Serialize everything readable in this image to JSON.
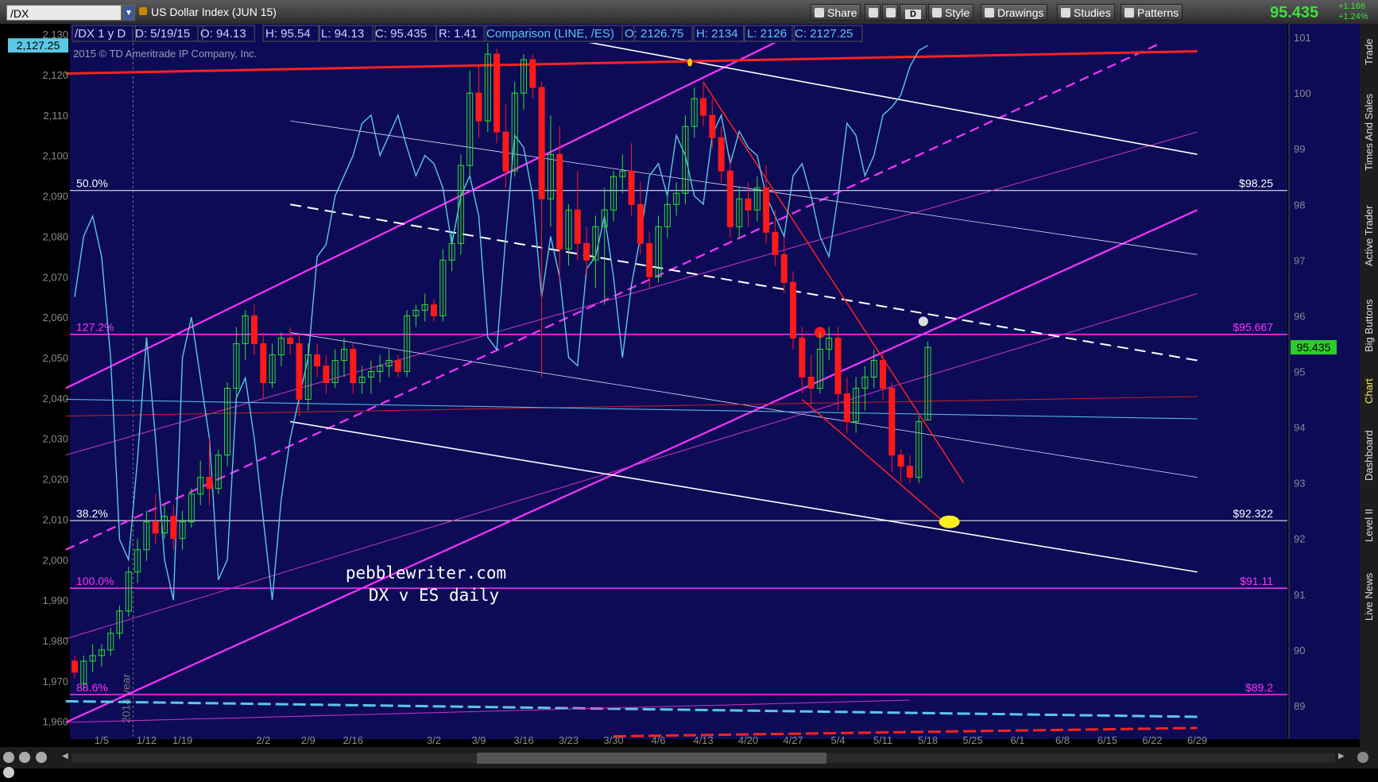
{
  "toolbar": {
    "symbol": "/DX",
    "instrument": "US Dollar Index (JUN 15)",
    "buttons": {
      "share": "Share",
      "d": "D",
      "style": "Style",
      "drawings": "Drawings",
      "studies": "Studies",
      "patterns": "Patterns"
    },
    "last_price": "95.435",
    "change_abs": "+1.166",
    "change_pct": "+1.24%"
  },
  "sidebar": {
    "tabs": [
      "Trade",
      "Times And Sales",
      "Active Trader",
      "Big Buttons",
      "Chart",
      "Dashboard",
      "Level II",
      "Live News"
    ],
    "active": "Chart"
  },
  "colors": {
    "background": "#0d0b56",
    "up": "#2ee02e",
    "down": "#ff1a1a",
    "comparison": "#5bc8e6",
    "magenta": "#ff33ff",
    "red_line": "#ff2222",
    "white_line": "#ffffff"
  },
  "chart_data": {
    "type": "candlestick",
    "header": {
      "symbol_period": "/DX 1 y D",
      "date": "D: 5/19/15",
      "open": "O: 94.13",
      "high": "H: 95.54",
      "low": "L: 94.13",
      "close": "C: 95.435",
      "range": "R: 1.41",
      "comparison": "Comparison (LINE, /ES)",
      "cmp_open": "O: 2126.75",
      "cmp_high": "H: 2134",
      "cmp_low": "L: 2126",
      "cmp_close": "C: 2127.25"
    },
    "copyright": "2015 © TD Ameritrade IP Company, Inc.",
    "watermark": [
      "pebblewriter.com",
      "DX v ES daily"
    ],
    "year_marker": "2014 year",
    "right_axis": {
      "min": 88.5,
      "max": 101.2,
      "ticks": [
        89,
        90,
        91,
        92,
        93,
        94,
        95,
        96,
        97,
        98,
        99,
        100,
        101
      ]
    },
    "left_axis": {
      "min": 1957,
      "max": 2132,
      "ticks": [
        1960,
        1970,
        1980,
        1990,
        2000,
        2010,
        2020,
        2030,
        2040,
        2050,
        2060,
        2070,
        2080,
        2090,
        2100,
        2110,
        2120,
        2130
      ],
      "tick_labels": [
        "1,960",
        "1,970",
        "1,980",
        "1,990",
        "2,000",
        "2,010",
        "2,020",
        "2,030",
        "2,040",
        "2,050",
        "2,060",
        "2,070",
        "2,080",
        "2,090",
        "2,100",
        "2,110",
        "2,120",
        "2,130"
      ],
      "current_label": "2,127.25",
      "current_value": 2127.25
    },
    "price_label": "95.435",
    "x_ticks": [
      {
        "label": "1/5",
        "i": 3
      },
      {
        "label": "1/12",
        "i": 8
      },
      {
        "label": "1/19",
        "i": 12
      },
      {
        "label": "2/2",
        "i": 21
      },
      {
        "label": "2/9",
        "i": 26
      },
      {
        "label": "2/16",
        "i": 31
      },
      {
        "label": "3/2",
        "i": 40
      },
      {
        "label": "3/9",
        "i": 45
      },
      {
        "label": "3/16",
        "i": 50
      },
      {
        "label": "3/23",
        "i": 55
      },
      {
        "label": "3/30",
        "i": 60
      },
      {
        "label": "4/6",
        "i": 65
      },
      {
        "label": "4/13",
        "i": 70
      },
      {
        "label": "4/20",
        "i": 75
      },
      {
        "label": "4/27",
        "i": 80
      },
      {
        "label": "5/4",
        "i": 85
      },
      {
        "label": "5/11",
        "i": 90
      },
      {
        "label": "5/18",
        "i": 95
      },
      {
        "label": "5/25",
        "i": 100
      },
      {
        "label": "6/1",
        "i": 105
      },
      {
        "label": "6/8",
        "i": 110
      },
      {
        "label": "6/15",
        "i": 115
      },
      {
        "label": "6/22",
        "i": 120
      },
      {
        "label": "6/29",
        "i": 125
      }
    ],
    "fib_levels": [
      {
        "pct": "50.0%",
        "price": "$98.25",
        "value": 98.25,
        "color": "#ffffff"
      },
      {
        "pct": "127.2%",
        "price": "$95.667",
        "value": 95.667,
        "color": "#ff33ff"
      },
      {
        "pct": "38.2%",
        "price": "$92.322",
        "value": 92.322,
        "color": "#ffffff"
      },
      {
        "pct": "100.0%",
        "price": "$91.11",
        "value": 91.11,
        "color": "#ff33ff"
      },
      {
        "pct": "88.6%",
        "price": "$89.2",
        "value": 89.2,
        "color": "#ff33ff"
      }
    ],
    "candles": [
      [
        89.8,
        89.9,
        89.5,
        89.6
      ],
      [
        89.4,
        89.9,
        89.3,
        89.8
      ],
      [
        89.8,
        90.1,
        89.6,
        89.9
      ],
      [
        89.9,
        90.1,
        89.7,
        90.0
      ],
      [
        90.0,
        90.4,
        89.9,
        90.3
      ],
      [
        90.3,
        90.8,
        90.2,
        90.7
      ],
      [
        90.7,
        91.5,
        90.6,
        91.4
      ],
      [
        91.4,
        92.0,
        91.2,
        91.8
      ],
      [
        91.8,
        92.5,
        91.6,
        92.3
      ],
      [
        92.3,
        92.8,
        91.9,
        92.1
      ],
      [
        92.1,
        92.6,
        92.0,
        92.4
      ],
      [
        92.4,
        92.6,
        91.8,
        92.0
      ],
      [
        92.0,
        92.5,
        91.8,
        92.3
      ],
      [
        92.3,
        92.9,
        92.2,
        92.8
      ],
      [
        92.8,
        93.4,
        92.6,
        93.1
      ],
      [
        93.1,
        93.8,
        92.6,
        92.9
      ],
      [
        92.9,
        93.6,
        92.8,
        93.5
      ],
      [
        93.5,
        94.8,
        93.3,
        94.7
      ],
      [
        94.7,
        95.8,
        94.5,
        95.5
      ],
      [
        95.5,
        96.1,
        95.2,
        96.0
      ],
      [
        96.0,
        96.2,
        95.3,
        95.5
      ],
      [
        95.5,
        95.7,
        94.5,
        94.8
      ],
      [
        94.8,
        95.5,
        94.7,
        95.3
      ],
      [
        95.3,
        95.7,
        95.1,
        95.6
      ],
      [
        95.6,
        95.8,
        95.3,
        95.5
      ],
      [
        95.5,
        95.7,
        94.2,
        94.5
      ],
      [
        94.5,
        95.5,
        94.3,
        95.3
      ],
      [
        95.3,
        95.5,
        94.9,
        95.1
      ],
      [
        95.1,
        95.3,
        94.6,
        94.8
      ],
      [
        94.8,
        95.4,
        94.7,
        95.2
      ],
      [
        95.2,
        95.6,
        94.9,
        95.4
      ],
      [
        95.4,
        95.5,
        94.6,
        94.8
      ],
      [
        94.8,
        95.1,
        94.6,
        94.9
      ],
      [
        94.9,
        95.2,
        94.6,
        95.0
      ],
      [
        95.0,
        95.3,
        94.8,
        95.1
      ],
      [
        95.1,
        95.4,
        94.9,
        95.2
      ],
      [
        95.2,
        95.3,
        94.9,
        95.0
      ],
      [
        95.0,
        96.1,
        94.9,
        96.0
      ],
      [
        96.0,
        96.2,
        95.8,
        96.1
      ],
      [
        96.1,
        96.4,
        95.9,
        96.2
      ],
      [
        96.2,
        96.3,
        95.9,
        96.0
      ],
      [
        96.0,
        97.2,
        95.9,
        97.0
      ],
      [
        97.0,
        97.5,
        96.8,
        97.3
      ],
      [
        97.3,
        98.9,
        97.1,
        98.7
      ],
      [
        98.7,
        100.4,
        98.5,
        100.0
      ],
      [
        100.0,
        100.5,
        99.2,
        99.5
      ],
      [
        99.5,
        100.9,
        99.3,
        100.7
      ],
      [
        100.7,
        100.8,
        99.1,
        99.3
      ],
      [
        99.3,
        99.8,
        98.3,
        98.6
      ],
      [
        98.6,
        100.2,
        98.5,
        100.0
      ],
      [
        100.0,
        100.7,
        99.7,
        100.6
      ],
      [
        100.6,
        100.7,
        99.9,
        100.1
      ],
      [
        100.1,
        100.2,
        94.9,
        98.1
      ],
      [
        98.1,
        99.6,
        97.6,
        98.9
      ],
      [
        98.9,
        99.4,
        96.6,
        97.2
      ],
      [
        97.2,
        98.0,
        96.9,
        97.9
      ],
      [
        97.9,
        98.6,
        97.0,
        97.3
      ],
      [
        97.3,
        97.6,
        96.7,
        97.0
      ],
      [
        97.0,
        97.8,
        96.5,
        97.6
      ],
      [
        97.6,
        98.3,
        96.2,
        97.9
      ],
      [
        97.9,
        98.6,
        97.7,
        98.5
      ],
      [
        98.5,
        98.9,
        98.2,
        98.6
      ],
      [
        98.6,
        99.1,
        97.8,
        98.0
      ],
      [
        98.0,
        98.4,
        97.1,
        97.3
      ],
      [
        97.3,
        97.5,
        96.5,
        96.7
      ],
      [
        96.7,
        97.8,
        96.6,
        97.6
      ],
      [
        97.6,
        98.2,
        97.4,
        98.0
      ],
      [
        98.0,
        98.4,
        97.8,
        98.2
      ],
      [
        98.2,
        99.6,
        98.0,
        99.4
      ],
      [
        99.4,
        100.1,
        99.2,
        99.9
      ],
      [
        99.9,
        100.2,
        99.4,
        99.6
      ],
      [
        99.6,
        99.9,
        99.0,
        99.2
      ],
      [
        99.2,
        99.4,
        98.4,
        98.6
      ],
      [
        98.6,
        98.9,
        97.4,
        97.6
      ],
      [
        97.6,
        98.3,
        97.4,
        98.1
      ],
      [
        98.1,
        98.4,
        97.6,
        97.9
      ],
      [
        97.9,
        98.5,
        97.7,
        98.3
      ],
      [
        98.3,
        98.7,
        97.3,
        97.5
      ],
      [
        97.5,
        97.9,
        96.9,
        97.1
      ],
      [
        97.1,
        97.4,
        96.4,
        96.6
      ],
      [
        96.6,
        96.8,
        95.4,
        95.6
      ],
      [
        95.6,
        95.8,
        94.6,
        94.9
      ],
      [
        94.9,
        95.3,
        94.4,
        94.7
      ],
      [
        94.7,
        95.7,
        94.6,
        95.4
      ],
      [
        95.4,
        95.8,
        95.2,
        95.6
      ],
      [
        95.6,
        95.8,
        94.3,
        94.6
      ],
      [
        94.6,
        94.9,
        93.9,
        94.1
      ],
      [
        94.1,
        94.9,
        93.9,
        94.7
      ],
      [
        94.7,
        95.1,
        94.3,
        94.9
      ],
      [
        94.9,
        95.4,
        94.7,
        95.2
      ],
      [
        95.2,
        95.4,
        94.5,
        94.7
      ],
      [
        94.7,
        94.8,
        93.2,
        93.5
      ],
      [
        93.5,
        93.6,
        93.0,
        93.3
      ],
      [
        93.3,
        93.5,
        93.0,
        93.1
      ],
      [
        93.1,
        94.2,
        93.0,
        94.1
      ],
      [
        94.13,
        95.54,
        94.13,
        95.435
      ]
    ],
    "comparison_line": [
      [
        0,
        2065
      ],
      [
        1,
        2080
      ],
      [
        2,
        2085
      ],
      [
        3,
        2075
      ],
      [
        4,
        2050
      ],
      [
        5,
        2005
      ],
      [
        6,
        2000
      ],
      [
        7,
        2025
      ],
      [
        8,
        2055
      ],
      [
        9,
        2030
      ],
      [
        10,
        2000
      ],
      [
        11,
        1990
      ],
      [
        12,
        2050
      ],
      [
        13,
        2060
      ],
      [
        14,
        2045
      ],
      [
        15,
        2030
      ],
      [
        16,
        1995
      ],
      [
        17,
        2000
      ],
      [
        18,
        2040
      ],
      [
        19,
        2045
      ],
      [
        20,
        2030
      ],
      [
        21,
        2010
      ],
      [
        22,
        1990
      ],
      [
        23,
        2015
      ],
      [
        24,
        2030
      ],
      [
        25,
        2040
      ],
      [
        26,
        2050
      ],
      [
        27,
        2075
      ],
      [
        28,
        2078
      ],
      [
        29,
        2090
      ],
      [
        30,
        2095
      ],
      [
        31,
        2100
      ],
      [
        32,
        2108
      ],
      [
        33,
        2110
      ],
      [
        34,
        2100
      ],
      [
        35,
        2105
      ],
      [
        36,
        2110
      ],
      [
        37,
        2102
      ],
      [
        38,
        2095
      ],
      [
        39,
        2100
      ],
      [
        40,
        2098
      ],
      [
        41,
        2092
      ],
      [
        42,
        2078
      ],
      [
        43,
        2090
      ],
      [
        44,
        2095
      ],
      [
        45,
        2085
      ],
      [
        46,
        2055
      ],
      [
        47,
        2052
      ],
      [
        48,
        2080
      ],
      [
        49,
        2105
      ],
      [
        50,
        2102
      ],
      [
        51,
        2090
      ],
      [
        52,
        2065
      ],
      [
        53,
        2080
      ],
      [
        54,
        2070
      ],
      [
        55,
        2050
      ],
      [
        56,
        2048
      ],
      [
        57,
        2072
      ],
      [
        58,
        2075
      ],
      [
        59,
        2085
      ],
      [
        60,
        2070
      ],
      [
        61,
        2050
      ],
      [
        62,
        2068
      ],
      [
        63,
        2080
      ],
      [
        64,
        2095
      ],
      [
        65,
        2098
      ],
      [
        66,
        2090
      ],
      [
        67,
        2105
      ],
      [
        68,
        2100
      ],
      [
        69,
        2090
      ],
      [
        70,
        2088
      ],
      [
        71,
        2105
      ],
      [
        72,
        2110
      ],
      [
        73,
        2098
      ],
      [
        74,
        2106
      ],
      [
        75,
        2102
      ],
      [
        76,
        2100
      ],
      [
        77,
        2090
      ],
      [
        78,
        2085
      ],
      [
        79,
        2080
      ],
      [
        80,
        2095
      ],
      [
        81,
        2098
      ],
      [
        82,
        2090
      ],
      [
        83,
        2080
      ],
      [
        84,
        2075
      ],
      [
        85,
        2090
      ],
      [
        86,
        2108
      ],
      [
        87,
        2105
      ],
      [
        88,
        2095
      ],
      [
        89,
        2100
      ],
      [
        90,
        2110
      ],
      [
        91,
        2112
      ],
      [
        92,
        2115
      ],
      [
        93,
        2122
      ],
      [
        94,
        2126
      ],
      [
        95,
        2127.25
      ]
    ]
  }
}
